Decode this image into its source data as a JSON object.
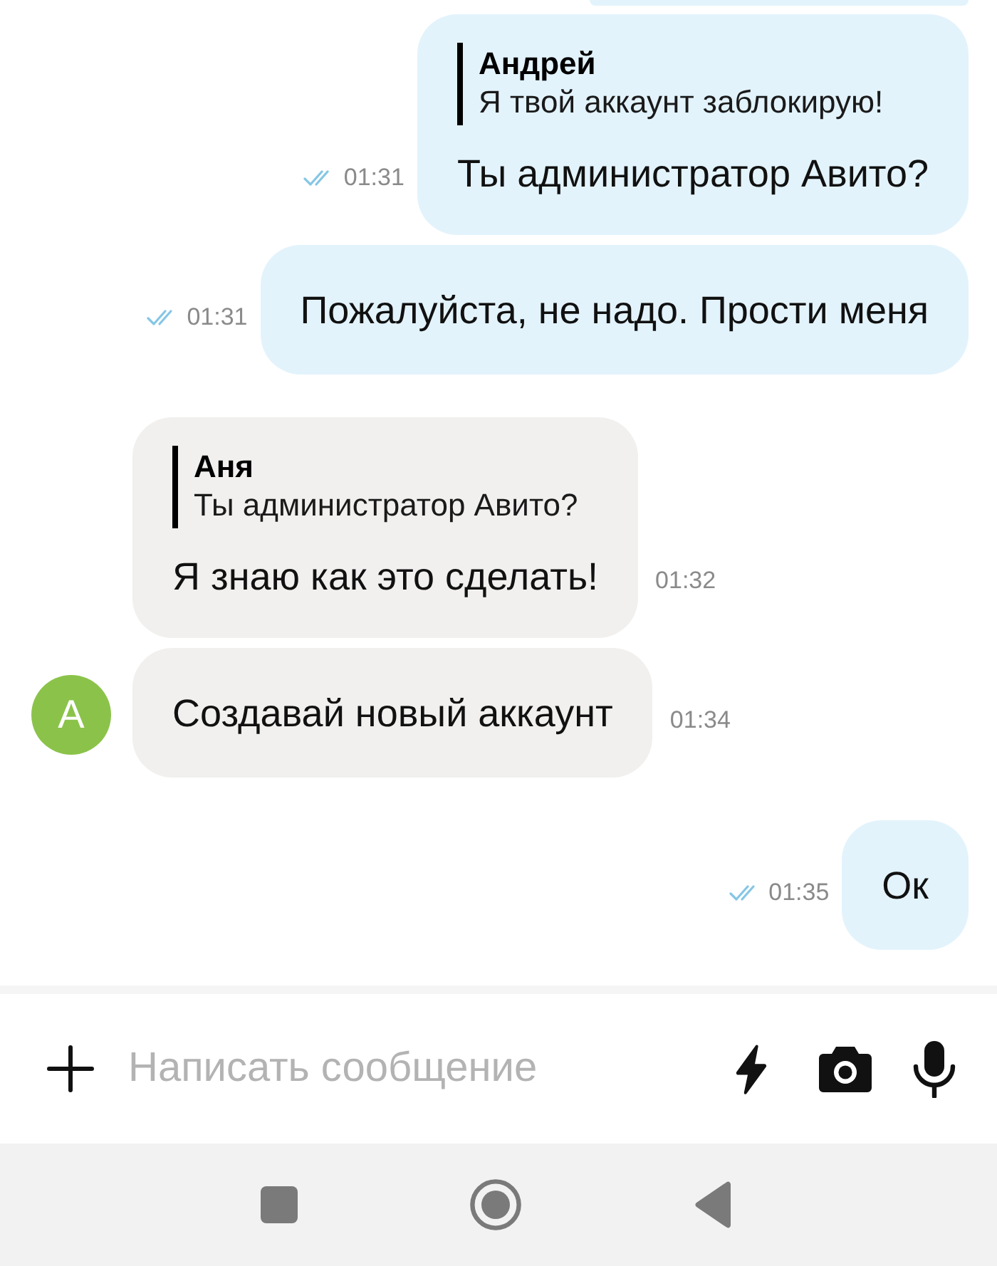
{
  "chat": {
    "clipped_bubble_at_top": true,
    "messages": [
      {
        "kind": "outgoing",
        "quote": {
          "author": "Андрей",
          "text": "Я твой аккаунт заблокирую!"
        },
        "text": "Ты администратор Авито?",
        "time": "01:31",
        "read": true
      },
      {
        "kind": "outgoing",
        "text": "Пожалуйста, не надо. Прости меня",
        "time": "01:31",
        "read": true
      },
      {
        "kind": "incoming",
        "quote": {
          "author": "Аня",
          "text": "Ты администратор Авито?"
        },
        "text": "Я знаю как это сделать!",
        "time": "01:32"
      },
      {
        "kind": "incoming",
        "avatar": {
          "letter": "А"
        },
        "text": "Создавай новый аккаунт",
        "time": "01:34"
      },
      {
        "kind": "outgoing",
        "text": "Ок",
        "time": "01:35",
        "read": true
      }
    ]
  },
  "composer": {
    "placeholder": "Написать сообщение"
  }
}
